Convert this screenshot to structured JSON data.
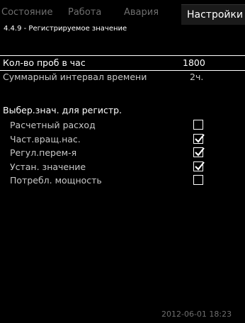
{
  "tabs": [
    {
      "label": "Состояние",
      "active": false
    },
    {
      "label": "Работа",
      "active": false
    },
    {
      "label": "Авария",
      "active": false
    },
    {
      "label": "Настройки",
      "active": true
    }
  ],
  "subtitle": "4.4.9 - Регистрируемое значение",
  "samples": {
    "label": "Кол-во проб в час",
    "value": "1800"
  },
  "interval": {
    "label": "Суммарный интервал времени",
    "value": "2ч."
  },
  "section_title": "Выбер.знач. для регистр.",
  "options": [
    {
      "label": "Расчетный расход",
      "checked": false
    },
    {
      "label": "Част.вращ.нас.",
      "checked": true
    },
    {
      "label": "Регул.перем-я",
      "checked": true
    },
    {
      "label": "Устан. значение",
      "checked": true
    },
    {
      "label": "Потребл. мощность",
      "checked": false
    }
  ],
  "timestamp": "2012-06-01 18:23",
  "colors": {
    "background": "#000000",
    "text": "#ffffff",
    "inactive_tab": "#6e6e6e",
    "active_tab_bg": "#1a1a1a"
  }
}
